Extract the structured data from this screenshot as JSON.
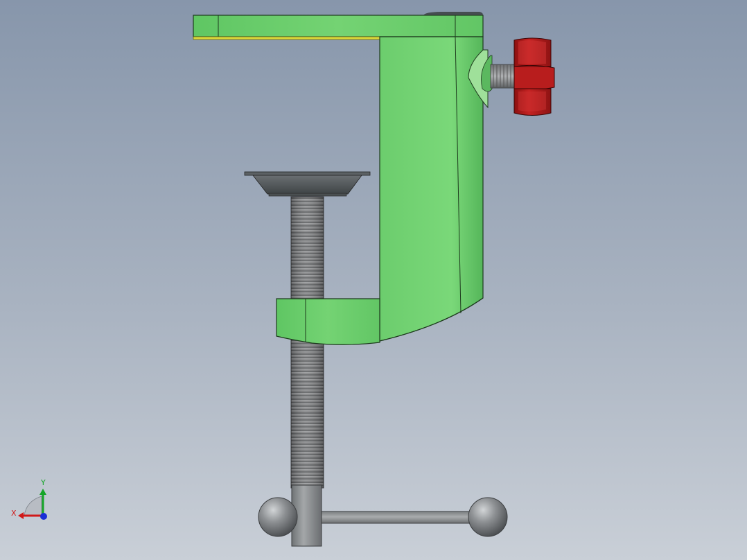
{
  "viewport": {
    "background_top": "#8796ab",
    "background_bottom": "#c9cfd7"
  },
  "model": {
    "parts": [
      {
        "name": "clamp-body",
        "color": "#6ccc6e"
      },
      {
        "name": "jaw-pad",
        "color": "#555b5e"
      },
      {
        "name": "threaded-rod",
        "color": "#7e7e80"
      },
      {
        "name": "t-handle-bar",
        "color": "#8d9092"
      },
      {
        "name": "ball-knob-left",
        "color": "#8a8d8f"
      },
      {
        "name": "ball-knob-right",
        "color": "#8a8d8f"
      },
      {
        "name": "lock-knob",
        "color": "#b11c1c"
      },
      {
        "name": "lock-screw",
        "color": "#7e7e80"
      },
      {
        "name": "top-edge-strip",
        "color": "#d8d63a"
      }
    ]
  },
  "triad": {
    "x_label": "X",
    "y_label": "Y",
    "x_color": "#d01818",
    "y_color": "#15a528",
    "z_color": "#1a2fd6"
  }
}
